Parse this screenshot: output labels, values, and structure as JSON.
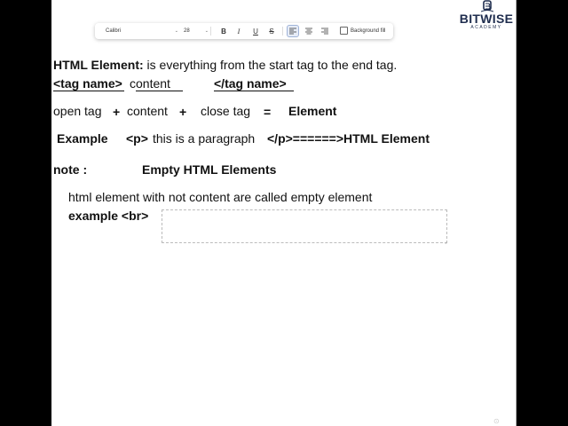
{
  "toolbar": {
    "font": "Calibri",
    "size": "28",
    "bold": "B",
    "italic": "I",
    "underline": "U",
    "strike": "S",
    "background_fill": "Background fill"
  },
  "logo": {
    "name_part1": "BIT",
    "name_part2": "WISE",
    "subtitle": "ACADEMY"
  },
  "content": {
    "line1_bold": "HTML Element:",
    "line1_rest": "is everything from the start tag to the end tag.",
    "tag_name_open": "<tag name>",
    "content_word": "content",
    "tag_name_close": "</tag name>",
    "open_tag": "open tag",
    "plus1": "+",
    "content2": "content",
    "plus2": "+",
    "close_tag": "close tag",
    "equals": "=",
    "element": "Element",
    "example_label": "Example",
    "p_open": "<p>",
    "example_text": "this is a paragraph",
    "p_close": "</p>======>HTML Element",
    "note_label": "note :",
    "empty_heading": "Empty HTML Elements",
    "empty_desc": "html element with not content are called empty element",
    "example_br": "example <br>"
  }
}
